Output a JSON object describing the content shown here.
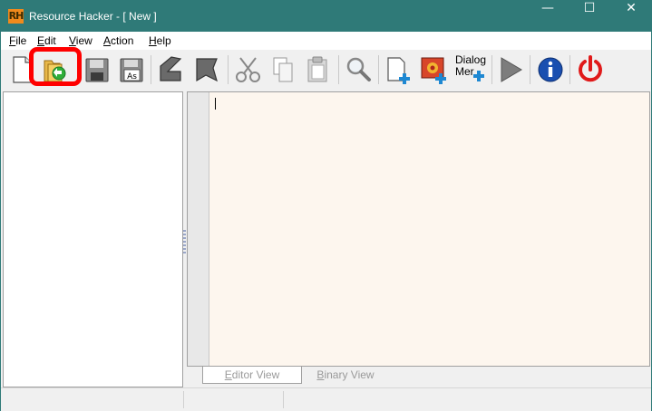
{
  "window": {
    "title": "Resource Hacker - [ New ]",
    "app_icon_text": "RH",
    "controls": {
      "minimize": "—",
      "maximize": "☐",
      "close": "✕"
    }
  },
  "menu": {
    "items": [
      {
        "label": "File"
      },
      {
        "label": "Edit"
      },
      {
        "label": "View"
      },
      {
        "label": "Action"
      },
      {
        "label": "Help"
      }
    ]
  },
  "toolbar": {
    "buttons": [
      {
        "icon": "new-file-icon"
      },
      {
        "icon": "open-folder-icon",
        "highlighted": true
      },
      {
        "icon": "save-icon"
      },
      {
        "icon": "save-as-icon",
        "badge": "As"
      },
      {
        "icon": "compile-icon"
      },
      {
        "icon": "script-icon"
      },
      {
        "icon": "cut-icon"
      },
      {
        "icon": "copy-icon"
      },
      {
        "icon": "paste-icon"
      },
      {
        "icon": "find-icon"
      },
      {
        "icon": "add-resource-icon"
      },
      {
        "icon": "add-image-icon"
      },
      {
        "icon": "dialog-menu-icon",
        "label_line1": "Dialog",
        "label_line2": "Mer"
      },
      {
        "icon": "play-icon"
      },
      {
        "icon": "info-icon"
      },
      {
        "icon": "power-icon"
      }
    ],
    "highlight_color": "#ff0000"
  },
  "editor": {
    "tabs": [
      {
        "label": "Editor View",
        "active": true
      },
      {
        "label": "Binary View",
        "active": false
      }
    ],
    "background": "#fdf6ee"
  },
  "colors": {
    "titlebar": "#2f7a78",
    "info_blue": "#1a4fb0",
    "power_red": "#e01a1a"
  }
}
